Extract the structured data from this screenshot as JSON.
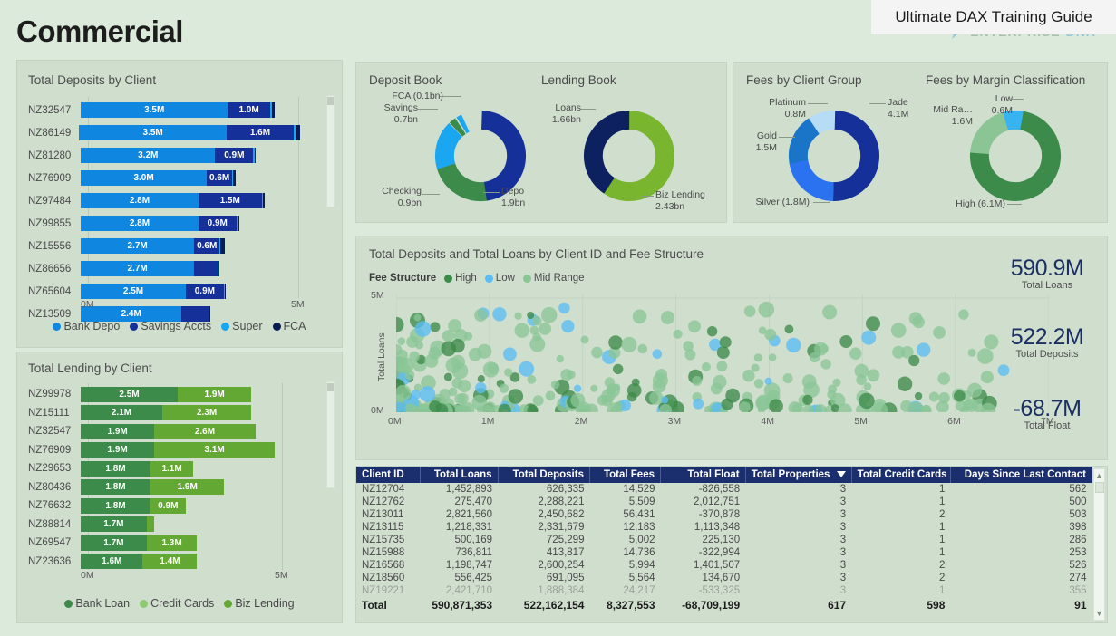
{
  "header": {
    "title": "Commercial",
    "overlay_label": "Ultimate DAX Training Guide",
    "watermark_part1": "ENTERPRISE",
    "watermark_part2": "DNA"
  },
  "colors": {
    "canvas": "#dceadb",
    "panel": "#cfdecd",
    "bank_depo": "#0f86e0",
    "savings_accts": "#16309a",
    "super": "#1aa6f0",
    "fca": "#071d55",
    "bank_loan": "#3d8b4a",
    "credit_cards": "#8ec96f",
    "biz_lending": "#63a832",
    "jade": "#16309a",
    "gold": "#1a74c8",
    "platinum": "#b7dcf5",
    "silver": "#2a72f0",
    "high": "#3d8b4a",
    "low": "#38b3f2",
    "mid_range": "#8bc596",
    "kpi_text": "#1b2f63",
    "table_header": "#1b2f6e"
  },
  "deposits_panel": {
    "title": "Total Deposits by Client",
    "axis_min_label": "0M",
    "axis_max_label": "5M",
    "legend": [
      {
        "label": "Bank Depo",
        "color": "#0f86e0"
      },
      {
        "label": "Savings Accts",
        "color": "#16309a"
      },
      {
        "label": "Super",
        "color": "#1aa6f0"
      },
      {
        "label": "FCA",
        "color": "#071d55"
      }
    ]
  },
  "lending_panel": {
    "title": "Total Lending by Client",
    "axis_min_label": "0M",
    "axis_max_label": "5M",
    "legend": [
      {
        "label": "Bank Loan",
        "color": "#3d8b4a"
      },
      {
        "label": "Credit Cards",
        "color": "#8ec96f"
      },
      {
        "label": "Biz Lending",
        "color": "#63a832"
      }
    ]
  },
  "scatter_panel": {
    "title": "Total Deposits and Total Loans by Client ID and Fee Structure",
    "legend_label": "Fee Structure",
    "legend": [
      {
        "label": "High",
        "color": "#3d8b4a"
      },
      {
        "label": "Low",
        "color": "#5bbdf5"
      },
      {
        "label": "Mid Range",
        "color": "#8bc596"
      }
    ]
  },
  "kpis": [
    {
      "value": "590.9M",
      "label": "Total Loans"
    },
    {
      "value": "522.2M",
      "label": "Total Deposits"
    },
    {
      "value": "-68.7M",
      "label": "Total Float"
    }
  ],
  "donuts": {
    "deposit_book": {
      "title": "Deposit Book",
      "callouts": [
        {
          "label": "FCA (0.1bn)",
          "side": "left"
        },
        {
          "label": "Savings",
          "value": "0.7bn",
          "side": "left"
        },
        {
          "label": "Checking",
          "value": "0.9bn",
          "side": "left"
        },
        {
          "label": "Depo",
          "value": "1.9bn",
          "side": "right"
        }
      ]
    },
    "lending_book": {
      "title": "Lending Book",
      "callouts": [
        {
          "label": "Loans",
          "value": "1.66bn",
          "side": "left"
        },
        {
          "label": "Biz Lending",
          "value": "2.43bn",
          "side": "right"
        }
      ]
    },
    "fees_client_group": {
      "title": "Fees by Client Group",
      "callouts": [
        {
          "label": "Platinum",
          "value": "0.8M",
          "side": "left"
        },
        {
          "label": "Gold",
          "value": "1.5M",
          "side": "left"
        },
        {
          "label": "Silver (1.8M)",
          "side": "left"
        },
        {
          "label": "Jade",
          "value": "4.1M",
          "side": "right"
        }
      ]
    },
    "fees_margin": {
      "title": "Fees by Margin Classification",
      "callouts": [
        {
          "label": "Mid Ra…",
          "value": "1.6M",
          "side": "left"
        },
        {
          "label": "Low",
          "value": "0.6M",
          "side": "left"
        },
        {
          "label": "High (6.1M)",
          "side": "left"
        }
      ]
    }
  },
  "table": {
    "columns": [
      "Client ID",
      "Total Loans",
      "Total Deposits",
      "Total Fees",
      "Total Float",
      "Total Properties",
      "Total Credit Cards",
      "Days Since Last Contact"
    ],
    "sorted_column": "Total Properties",
    "rows": [
      [
        "NZ12704",
        "1,452,893",
        "626,335",
        "14,529",
        "-826,558",
        "3",
        "1",
        "562"
      ],
      [
        "NZ12762",
        "275,470",
        "2,288,221",
        "5,509",
        "2,012,751",
        "3",
        "1",
        "500"
      ],
      [
        "NZ13011",
        "2,821,560",
        "2,450,682",
        "56,431",
        "-370,878",
        "3",
        "2",
        "503"
      ],
      [
        "NZ13115",
        "1,218,331",
        "2,331,679",
        "12,183",
        "1,113,348",
        "3",
        "1",
        "398"
      ],
      [
        "NZ15735",
        "500,169",
        "725,299",
        "5,002",
        "225,130",
        "3",
        "1",
        "286"
      ],
      [
        "NZ15988",
        "736,811",
        "413,817",
        "14,736",
        "-322,994",
        "3",
        "1",
        "253"
      ],
      [
        "NZ16568",
        "1,198,747",
        "2,600,254",
        "5,994",
        "1,401,507",
        "3",
        "2",
        "526"
      ],
      [
        "NZ18560",
        "556,425",
        "691,095",
        "5,564",
        "134,670",
        "3",
        "2",
        "274"
      ],
      [
        "NZ19221",
        "2,421,710",
        "1,888,384",
        "24,217",
        "-533,325",
        "3",
        "1",
        "355"
      ]
    ],
    "total_row": [
      "Total",
      "590,871,353",
      "522,162,154",
      "8,327,553",
      "-68,709,199",
      "617",
      "598",
      "91"
    ]
  },
  "chart_data": [
    {
      "type": "bar",
      "orientation": "horizontal",
      "stacked": true,
      "title": "Total Deposits by Client",
      "xlabel": "",
      "ylabel": "",
      "xlim": [
        0,
        5000000
      ],
      "xtick_labels": [
        "0M",
        "5M"
      ],
      "categories": [
        "NZ32547",
        "NZ86149",
        "NZ81280",
        "NZ76909",
        "NZ97484",
        "NZ99855",
        "NZ15556",
        "NZ86656",
        "NZ65604",
        "NZ13509"
      ],
      "series": [
        {
          "name": "Bank Depo",
          "color": "#0f86e0",
          "values": [
            3.5,
            3.5,
            3.2,
            3.0,
            2.8,
            2.8,
            2.7,
            2.7,
            2.5,
            2.4
          ],
          "labels": [
            "3.5M",
            "3.5M",
            "3.2M",
            "3.0M",
            "2.8M",
            "2.8M",
            "2.7M",
            "2.7M",
            "2.5M",
            "2.4M"
          ]
        },
        {
          "name": "Savings Accts",
          "color": "#16309a",
          "values": [
            1.0,
            1.6,
            0.9,
            0.6,
            1.5,
            0.9,
            0.6,
            0.55,
            0.9,
            0.65
          ],
          "labels": [
            "1.0M",
            "1.6M",
            "0.9M",
            "0.6M",
            "1.5M",
            "0.9M",
            "0.6M",
            "",
            "0.9M",
            ""
          ]
        },
        {
          "name": "Super",
          "color": "#1aa6f0",
          "values": [
            0.04,
            0.05,
            0.03,
            0.02,
            0.04,
            0.03,
            0.02,
            0.02,
            0.02,
            0.02
          ],
          "labels": [
            "",
            "",
            "",
            "",
            "",
            "",
            "",
            "",
            "",
            ""
          ]
        },
        {
          "name": "FCA",
          "color": "#071d55",
          "values": [
            0.07,
            0.1,
            0.02,
            0.07,
            0.03,
            0.05,
            0.1,
            0.02,
            0.01,
            0.01
          ],
          "labels": [
            "",
            "",
            "",
            "",
            "",
            "",
            "",
            "",
            "",
            ""
          ]
        }
      ]
    },
    {
      "type": "bar",
      "orientation": "horizontal",
      "stacked": true,
      "title": "Total Lending by Client",
      "xlim": [
        0,
        5000000
      ],
      "xtick_labels": [
        "0M",
        "5M"
      ],
      "categories": [
        "NZ99978",
        "NZ15111",
        "NZ32547",
        "NZ76909",
        "NZ29653",
        "NZ80436",
        "NZ76632",
        "NZ88814",
        "NZ69547",
        "NZ23636"
      ],
      "series": [
        {
          "name": "Bank Loan",
          "color": "#3d8b4a",
          "values": [
            2.5,
            2.1,
            1.9,
            1.9,
            1.8,
            1.8,
            1.8,
            1.7,
            1.7,
            1.6
          ],
          "labels": [
            "2.5M",
            "2.1M",
            "1.9M",
            "1.9M",
            "1.8M",
            "1.8M",
            "1.8M",
            "1.7M",
            "1.7M",
            "1.6M"
          ]
        },
        {
          "name": "Credit Cards",
          "color": "#8ec96f",
          "values": [
            0.0,
            0.0,
            0.0,
            0.0,
            0.0,
            0.0,
            0.0,
            0.0,
            0.0,
            0.0
          ],
          "labels": [
            "",
            "",
            "",
            "",
            "",
            "",
            "",
            "",
            "",
            ""
          ]
        },
        {
          "name": "Biz Lending",
          "color": "#63a832",
          "values": [
            1.9,
            2.3,
            2.6,
            3.1,
            1.1,
            1.9,
            0.9,
            0.2,
            1.3,
            1.4
          ],
          "labels": [
            "1.9M",
            "2.3M",
            "2.6M",
            "3.1M",
            "1.1M",
            "1.9M",
            "0.9M",
            "",
            "1.3M",
            "1.4M"
          ]
        }
      ]
    },
    {
      "type": "pie",
      "subtype": "donut",
      "title": "Deposit Book",
      "labels": [
        "Depo",
        "Checking",
        "Savings",
        "FCA"
      ],
      "values": [
        1.9,
        0.9,
        0.7,
        0.1
      ],
      "value_labels": [
        "1.9bn",
        "0.9bn",
        "0.7bn",
        "0.1bn"
      ],
      "colors": [
        "#16309a",
        "#3d8b4a",
        "#1aa6f0",
        "#3d8b4a"
      ]
    },
    {
      "type": "pie",
      "subtype": "donut",
      "title": "Lending Book",
      "labels": [
        "Biz Lending",
        "Loans"
      ],
      "values": [
        2.43,
        1.66
      ],
      "value_labels": [
        "2.43bn",
        "1.66bn"
      ],
      "colors": [
        "#7ab52f",
        "#0d2160"
      ]
    },
    {
      "type": "pie",
      "subtype": "donut",
      "title": "Fees by Client Group",
      "labels": [
        "Jade",
        "Silver",
        "Gold",
        "Platinum"
      ],
      "values": [
        4.1,
        1.8,
        1.5,
        0.8
      ],
      "value_labels": [
        "4.1M",
        "1.8M",
        "1.5M",
        "0.8M"
      ],
      "colors": [
        "#16309a",
        "#2a72f0",
        "#1a74c8",
        "#b7dcf5"
      ]
    },
    {
      "type": "pie",
      "subtype": "donut",
      "title": "Fees by Margin Classification",
      "labels": [
        "High",
        "Mid Range",
        "Low"
      ],
      "values": [
        6.1,
        1.6,
        0.6
      ],
      "value_labels": [
        "6.1M",
        "1.6M",
        "0.6M"
      ],
      "colors": [
        "#3d8b4a",
        "#8bc596",
        "#38b3f2"
      ]
    },
    {
      "type": "scatter",
      "title": "Total Deposits and Total Loans by Client ID and Fee Structure",
      "xlabel": "",
      "ylabel": "Total Loans",
      "xlim": [
        0,
        7000000
      ],
      "ylim": [
        0,
        5500000
      ],
      "xtick_labels": [
        "0M",
        "1M",
        "2M",
        "3M",
        "4M",
        "5M",
        "6M",
        "7M"
      ],
      "ytick_labels": [
        "0M",
        "5M"
      ],
      "legend_title": "Fee Structure",
      "series": [
        {
          "name": "High",
          "color": "#3d8b4a"
        },
        {
          "name": "Low",
          "color": "#5bbdf5"
        },
        {
          "name": "Mid Range",
          "color": "#8bc596"
        }
      ]
    }
  ]
}
